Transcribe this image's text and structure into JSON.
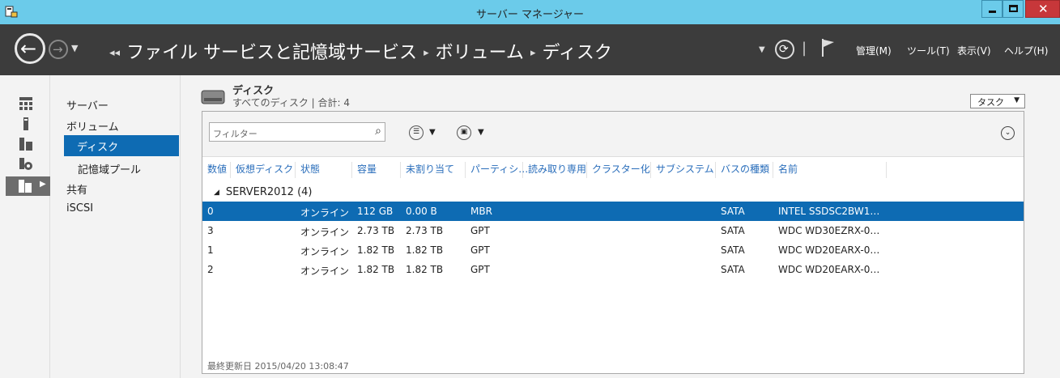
{
  "window": {
    "title": "サーバー マネージャー"
  },
  "header": {
    "breadcrumb": [
      "ファイル サービスと記憶域サービス",
      "ボリューム",
      "ディスク"
    ],
    "menus": [
      "管理(M)",
      "ツール(T)",
      "表示(V)",
      "ヘルプ(H)"
    ]
  },
  "nav": {
    "items": [
      "サーバー",
      "ボリューム",
      "ディスク",
      "記憶域プール",
      "共有",
      "iSCSI"
    ],
    "selected": "ディスク"
  },
  "section": {
    "title": "ディスク",
    "subtitle": "すべてのディスク | 合計: 4",
    "tasks_label": "タスク"
  },
  "toolbar": {
    "filter_placeholder": "フィルター"
  },
  "table": {
    "columns": [
      "数値",
      "仮想ディスク",
      "状態",
      "容量",
      "未割り当て",
      "パーティシ…",
      "読み取り専用",
      "クラスター化",
      "サブシステム",
      "バスの種類",
      "名前"
    ],
    "group_label": "SERVER2012 (4)",
    "rows": [
      {
        "num": "0",
        "status": "オンライン",
        "capacity": "112 GB",
        "unallocated": "0.00 B",
        "partition": "MBR",
        "bus": "SATA",
        "name": "INTEL SSDSC2BW1…",
        "selected": true
      },
      {
        "num": "3",
        "status": "オンライン",
        "capacity": "2.73 TB",
        "unallocated": "2.73 TB",
        "partition": "GPT",
        "bus": "SATA",
        "name": "WDC WD30EZRX-0…",
        "selected": false
      },
      {
        "num": "1",
        "status": "オンライン",
        "capacity": "1.82 TB",
        "unallocated": "1.82 TB",
        "partition": "GPT",
        "bus": "SATA",
        "name": "WDC WD20EARX-0…",
        "selected": false
      },
      {
        "num": "2",
        "status": "オンライン",
        "capacity": "1.82 TB",
        "unallocated": "1.82 TB",
        "partition": "GPT",
        "bus": "SATA",
        "name": "WDC WD20EARX-0…",
        "selected": false
      }
    ]
  },
  "footer": {
    "updated": "最終更新日 2015/04/20 13:08:47"
  }
}
